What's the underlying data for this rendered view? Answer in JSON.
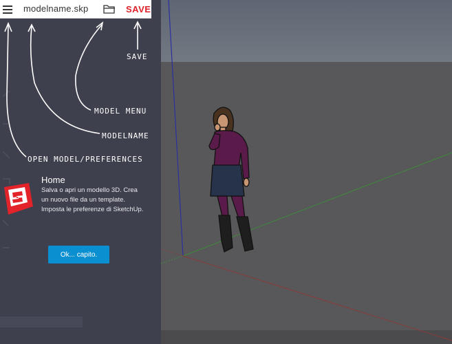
{
  "topbar": {
    "filename": "modelname.skp",
    "save_label": "SAVE"
  },
  "callouts": {
    "save": "save",
    "model_menu": "model menu",
    "modelname": "modelname",
    "open_model": "open model/preferences"
  },
  "home": {
    "title": "Home",
    "description": "Salva o apri un modello 3D. Crea un nuovo file da un template. Imposta le preferenze di SketchUp.",
    "ok_button": "Ok... capito."
  },
  "icons": {
    "menu": "hamburger-menu-icon",
    "folder": "folder-icon",
    "logo": "sketchup-logo-icon"
  },
  "colors": {
    "save": "#e0202a",
    "ok_button": "#0a8fd1",
    "panel": "#3f404d",
    "sky": "#6e7480",
    "ground": "#5a5a54"
  }
}
